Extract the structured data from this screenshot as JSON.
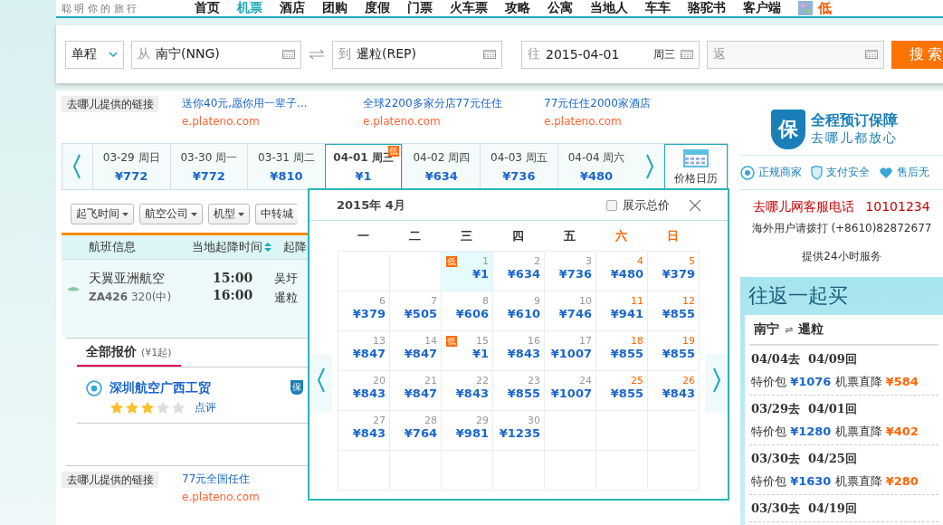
{
  "top_nav": {
    "tagline": "聪 明 你 的 旅 行",
    "items": [
      {
        "label": "首页",
        "selected": false
      },
      {
        "label": "机票",
        "selected": true
      },
      {
        "label": "酒店",
        "selected": false
      },
      {
        "label": "团购",
        "selected": false
      },
      {
        "label": "度假",
        "selected": false
      },
      {
        "label": "门票",
        "selected": false
      },
      {
        "label": "火车票",
        "selected": false
      },
      {
        "label": "攻略",
        "selected": false
      },
      {
        "label": "公寓",
        "selected": false
      },
      {
        "label": "当地人",
        "selected": false
      },
      {
        "label": "车车",
        "selected": false
      },
      {
        "label": "骆驼书",
        "selected": false
      },
      {
        "label": "客户端",
        "selected": false
      }
    ],
    "promo": "低"
  },
  "search": {
    "trip_type": "单程",
    "from": {
      "prefix": "从",
      "value": "南宁(NNG)"
    },
    "to": {
      "prefix": "到",
      "value": "暹粒(REP)"
    },
    "depart": {
      "prefix": "往",
      "value": "2015-04-01",
      "weekday": "周三"
    },
    "return": {
      "placeholder": "返"
    },
    "button": "搜索"
  },
  "ads_top": {
    "label": "去哪儿提供的链接",
    "links": [
      {
        "title": "送你40元,愿你用一辈子...",
        "url": "e.plateno.com"
      },
      {
        "title": "全球2200多家分店77元任住",
        "url": "e.plateno.com"
      },
      {
        "title": "77元任住2000家酒店",
        "url": "e.plateno.com"
      }
    ]
  },
  "date_strip": {
    "days": [
      {
        "date": "03-29 周日",
        "price": "¥772",
        "selected": false
      },
      {
        "date": "03-30 周一",
        "price": "¥772",
        "selected": false
      },
      {
        "date": "03-31 周二",
        "price": "¥810",
        "selected": false
      },
      {
        "date": "04-01 周三",
        "price": "¥1",
        "selected": true,
        "badge": "低"
      },
      {
        "date": "04-02 周四",
        "price": "¥634",
        "selected": false
      },
      {
        "date": "04-03 周五",
        "price": "¥736",
        "selected": false
      },
      {
        "date": "04-04 周六",
        "price": "¥480",
        "selected": false
      }
    ],
    "calendar_button": "价格日历"
  },
  "filters": [
    "起飞时间",
    "航空公司",
    "机型",
    "中转城"
  ],
  "table": {
    "columns": [
      "航班信息",
      "当地起降时间",
      "起降"
    ],
    "rows": [
      {
        "airline": "天翼亚洲航空",
        "flight": "ZA426",
        "aircraft": "320(中)",
        "depart_time": "15:00",
        "arrive_time": "16:00",
        "depart_airport": "吴圩",
        "arrive_airport": "暹粒"
      }
    ]
  },
  "quotes": {
    "tab": "全部报价",
    "tab_note": "(¥1起)",
    "vendor": "深圳航空广西工贸",
    "stars": 3,
    "review": "点评",
    "badge": "保"
  },
  "ads_bottom": {
    "label": "去哪儿提供的链接",
    "links": [
      {
        "title": "77元全国任住",
        "url": "e.plateno.com"
      }
    ]
  },
  "calendar": {
    "title": "2015年 4月",
    "show_total": {
      "label": "展示总价",
      "checked": false
    },
    "weekdays": [
      {
        "label": "一",
        "weekend": false
      },
      {
        "label": "二",
        "weekend": false
      },
      {
        "label": "三",
        "weekend": false
      },
      {
        "label": "四",
        "weekend": false
      },
      {
        "label": "五",
        "weekend": false
      },
      {
        "label": "六",
        "weekend": true
      },
      {
        "label": "日",
        "weekend": true
      }
    ],
    "weeks": [
      [
        {
          "kind": "empty"
        },
        {
          "kind": "empty"
        },
        {
          "kind": "day",
          "day": "1",
          "price": "¥1",
          "selected": true,
          "badge": "低"
        },
        {
          "kind": "day",
          "day": "2",
          "price": "¥634",
          "selected": false
        },
        {
          "kind": "day",
          "day": "3",
          "price": "¥736",
          "selected": false
        },
        {
          "kind": "day",
          "day": "4",
          "price": "¥480",
          "selected": false
        },
        {
          "kind": "day",
          "day": "5",
          "price": "¥379",
          "selected": false
        }
      ],
      [
        {
          "kind": "day",
          "day": "6",
          "price": "¥379",
          "selected": false
        },
        {
          "kind": "day",
          "day": "7",
          "price": "¥505",
          "selected": false
        },
        {
          "kind": "day",
          "day": "8",
          "price": "¥606",
          "selected": false
        },
        {
          "kind": "day",
          "day": "9",
          "price": "¥610",
          "selected": false
        },
        {
          "kind": "day",
          "day": "10",
          "price": "¥746",
          "selected": false
        },
        {
          "kind": "day",
          "day": "11",
          "price": "¥941",
          "selected": false
        },
        {
          "kind": "day",
          "day": "12",
          "price": "¥855",
          "selected": false
        }
      ],
      [
        {
          "kind": "day",
          "day": "13",
          "price": "¥847",
          "selected": false
        },
        {
          "kind": "day",
          "day": "14",
          "price": "¥847",
          "selected": false
        },
        {
          "kind": "day",
          "day": "15",
          "price": "¥1",
          "selected": false,
          "badge": "低"
        },
        {
          "kind": "day",
          "day": "16",
          "price": "¥843",
          "selected": false
        },
        {
          "kind": "day",
          "day": "17",
          "price": "¥1007",
          "selected": false
        },
        {
          "kind": "day",
          "day": "18",
          "price": "¥855",
          "selected": false
        },
        {
          "kind": "day",
          "day": "19",
          "price": "¥855",
          "selected": false
        }
      ],
      [
        {
          "kind": "day",
          "day": "20",
          "price": "¥843",
          "selected": false
        },
        {
          "kind": "day",
          "day": "21",
          "price": "¥847",
          "selected": false
        },
        {
          "kind": "day",
          "day": "22",
          "price": "¥843",
          "selected": false
        },
        {
          "kind": "day",
          "day": "23",
          "price": "¥855",
          "selected": false
        },
        {
          "kind": "day",
          "day": "24",
          "price": "¥1007",
          "selected": false
        },
        {
          "kind": "day",
          "day": "25",
          "price": "¥855",
          "selected": false
        },
        {
          "kind": "day",
          "day": "26",
          "price": "¥843",
          "selected": false
        }
      ],
      [
        {
          "kind": "day",
          "day": "27",
          "price": "¥843",
          "selected": false
        },
        {
          "kind": "day",
          "day": "28",
          "price": "¥764",
          "selected": false
        },
        {
          "kind": "day",
          "day": "29",
          "price": "¥981",
          "selected": false
        },
        {
          "kind": "day",
          "day": "30",
          "price": "¥1235",
          "selected": false
        },
        {
          "kind": "empty"
        },
        {
          "kind": "empty"
        },
        {
          "kind": "empty"
        }
      ],
      [
        {
          "kind": "empty"
        },
        {
          "kind": "empty"
        },
        {
          "kind": "empty"
        },
        {
          "kind": "empty"
        },
        {
          "kind": "empty"
        },
        {
          "kind": "empty"
        },
        {
          "kind": "empty"
        }
      ]
    ]
  },
  "guarantee": {
    "badge": "保",
    "title": "全程预订保障",
    "subtitle": "去哪儿都放心"
  },
  "trust": [
    {
      "kind": "merchant",
      "label": "正规商家"
    },
    {
      "kind": "payment",
      "label": "支付安全"
    },
    {
      "kind": "aftersale",
      "label": "售后无"
    }
  ],
  "hotline": {
    "label": "去哪儿网客服电话",
    "number": "10101234",
    "overseas": "海外用户请拨打 (+8610)82872677",
    "note": "提供24小时服务"
  },
  "roundtrip": {
    "title": "往返一起买",
    "route_from": "南宁",
    "route_arrow": "⇌",
    "route_to": "暹粒",
    "offers": [
      {
        "out": "04/04去",
        "back": "04/09回",
        "package_label": "特价包",
        "package_price": "¥1076",
        "drop_label": "机票直降",
        "drop": "¥584"
      },
      {
        "out": "03/29去",
        "back": "04/01回",
        "package_label": "特价包",
        "package_price": "¥1280",
        "drop_label": "机票直降",
        "drop": "¥402"
      },
      {
        "out": "03/30去",
        "back": "04/25回",
        "package_label": "特价包",
        "package_price": "¥1630",
        "drop_label": "机票直降",
        "drop": "¥280"
      },
      {
        "out": "03/30去",
        "back": "04/19回"
      }
    ]
  }
}
